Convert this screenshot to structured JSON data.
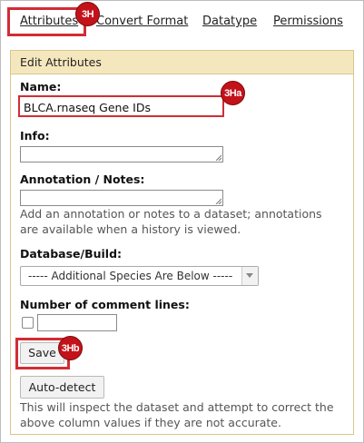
{
  "tabs": [
    {
      "label": "Attributes"
    },
    {
      "label": "Convert Format"
    },
    {
      "label": "Datatype"
    },
    {
      "label": "Permissions"
    }
  ],
  "panel": {
    "title": "Edit Attributes"
  },
  "form": {
    "name_label": "Name:",
    "name_value": "BLCA.rnaseq Gene IDs",
    "info_label": "Info:",
    "annotation_label": "Annotation / Notes:",
    "annotation_help": "Add an annotation or notes to a dataset; annotations are available when a history is viewed.",
    "dbkey_label": "Database/Build:",
    "dbkey_selected": "----- Additional Species Are Below -----",
    "comment_lines_label": "Number of comment lines:",
    "save_label": "Save",
    "autodetect_label": "Auto-detect",
    "autodetect_help": "This will inspect the dataset and attempt to correct the above column values if they are not accurate."
  },
  "callouts": {
    "tabs": "3H",
    "name": "3Ha",
    "save": "3Hb"
  },
  "colors": {
    "highlight": "#d12d35",
    "badge": "#c4121a",
    "panel_header": "#f5e7bd",
    "panel_border": "#d9c68e"
  }
}
